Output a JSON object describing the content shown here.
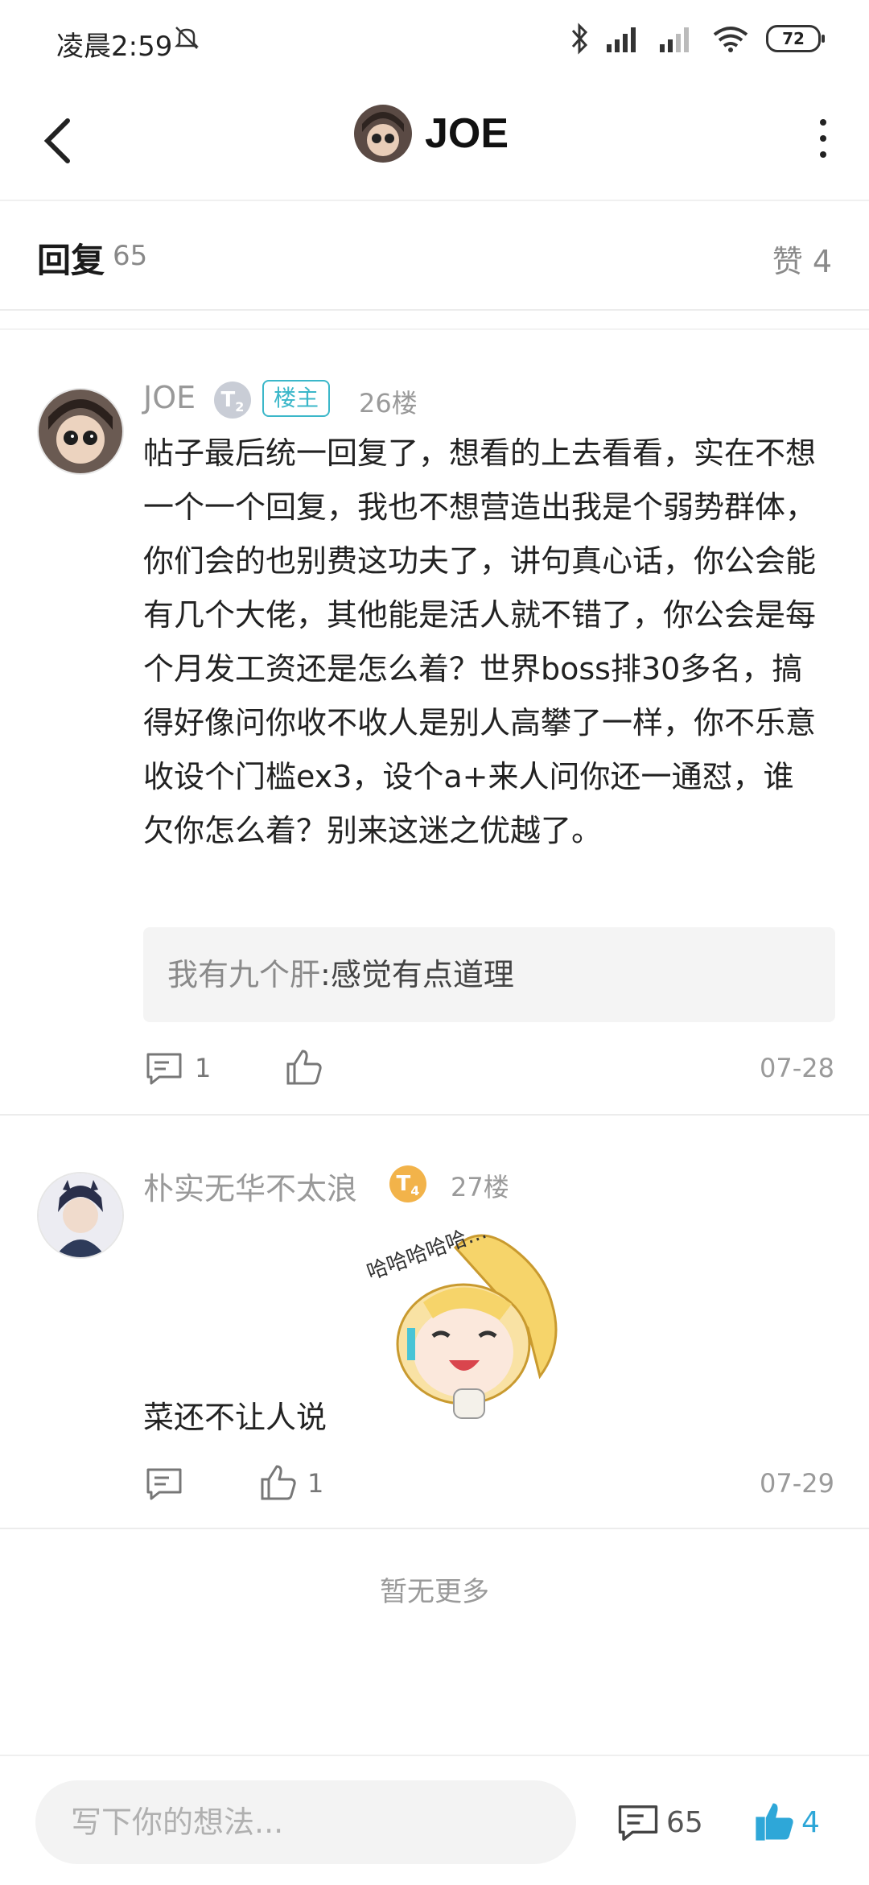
{
  "status_bar": {
    "time": "凌晨2:59",
    "battery": "72"
  },
  "header": {
    "title": "JOE"
  },
  "reply_bar": {
    "label": "回复",
    "count": "65",
    "likes": "赞 4"
  },
  "posts": [
    {
      "username": "JOE",
      "level": "T",
      "level_sub": "2",
      "badge": "楼主",
      "floor": "26楼",
      "content": "帖子最后统一回复了，想看的上去看看，实在不想一个一个回复，我也不想营造出我是个弱势群体，你们会的也别费这功夫了，讲句真心话，你公会能有几个大佬，其他能是活人就不错了，你公会是每个月发工资还是怎么着？世界boss排30多名，搞得好像问你收不收人是别人高攀了一样，你不乐意收设个门槛ex3，设个a+来人问你还一通怼，谁欠你怎么着？别来这迷之优越了。",
      "quote_name": "我有九个肝",
      "quote_text": ":感觉有点道理",
      "comments": "1",
      "likes": "",
      "date": "07-28"
    },
    {
      "username": "朴实无华不太浪",
      "level": "T",
      "level_sub": "4",
      "floor": "27楼",
      "content": "菜还不让人说",
      "sticker_text": "哈哈哈哈哈…",
      "comments": "",
      "likes": "1",
      "date": "07-29"
    }
  ],
  "no_more": "暂无更多",
  "bottom_bar": {
    "placeholder": "写下你的想法...",
    "comment_count": "65",
    "like_count": "4"
  },
  "colors": {
    "accent": "#2ea7d8",
    "badge": "#3bb7c9",
    "gold": "#f2b34a"
  }
}
